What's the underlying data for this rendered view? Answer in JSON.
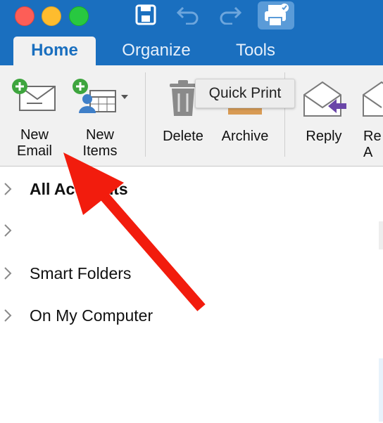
{
  "toolbar": {
    "window_controls": [
      "close",
      "minimize",
      "zoom"
    ],
    "quick_access_icons": [
      "save-icon",
      "undo-icon",
      "redo-icon",
      "print-icon"
    ]
  },
  "tabs": [
    {
      "label": "Home",
      "active": true
    },
    {
      "label": "Organize",
      "active": false
    },
    {
      "label": "Tools",
      "active": false
    }
  ],
  "ribbon": {
    "new_email": "New\nEmail",
    "new_items": "New\nItems",
    "delete": "Delete",
    "archive": "Archive",
    "reply": "Reply",
    "reply_all_partial": "Re\nA"
  },
  "tooltip": "Quick Print",
  "folders": [
    {
      "label": "All Accounts",
      "bold": true
    },
    {
      "label": "",
      "bold": false
    },
    {
      "label": "Smart Folders",
      "bold": false
    },
    {
      "label": "On My Computer",
      "bold": false
    }
  ],
  "colors": {
    "accent": "#1a6fbf",
    "annotation_arrow": "#f21c0d"
  }
}
